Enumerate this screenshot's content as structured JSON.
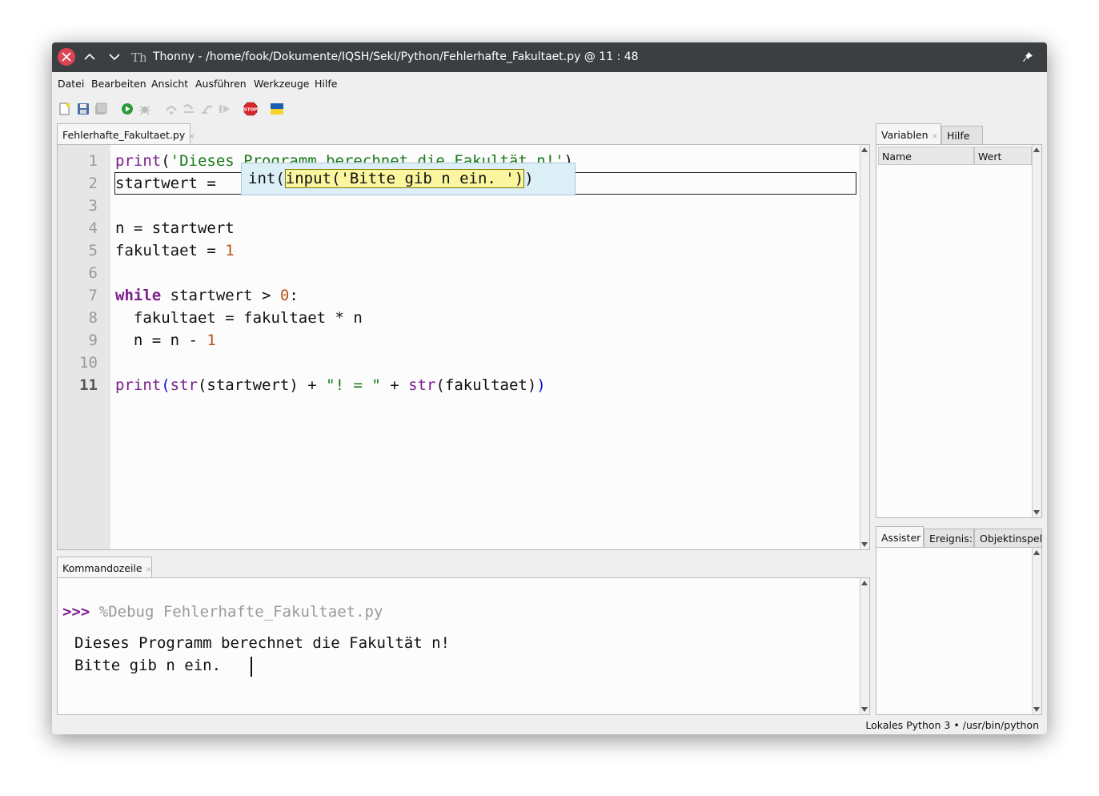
{
  "window": {
    "title": "Thonny - /home/fook/Dokumente/IQSH/SekI/Python/Fehlerhafte_Fakultaet.py @ 11 : 48",
    "icons": [
      "close-icon",
      "chevron-up-icon",
      "chevron-down-icon",
      "app-icon",
      "pin-icon"
    ]
  },
  "menu": {
    "items": [
      "Datei",
      "Bearbeiten",
      "Ansicht",
      "Ausführen",
      "Werkzeuge",
      "Hilfe"
    ]
  },
  "toolbar": {
    "icons": [
      "new-file-icon",
      "save-icon",
      "save-all-icon",
      "run-icon",
      "debug-icon",
      "step-over-icon",
      "step-into-icon",
      "step-out-icon",
      "resume-icon",
      "stop-icon",
      "ukraine-flag-icon"
    ],
    "stop_label": "STOP"
  },
  "editor": {
    "tab_label": "Fehlerhafte_Fakultaet.py",
    "tab_close": "×",
    "line_numbers": [
      "1",
      "2",
      "3",
      "4",
      "5",
      "6",
      "7",
      "8",
      "9",
      "10",
      "11"
    ],
    "lines": [
      {
        "plain_start": "",
        "kw": "print",
        "rest": "(",
        "str": "'Dieses Programm berechnet die Fakultät n!'",
        "end": ")"
      },
      {
        "text": "startwert = "
      },
      {
        "text": ""
      },
      {
        "text": "n = startwert"
      },
      {
        "text": "fakultaet = ",
        "num": "1"
      },
      {
        "text": ""
      },
      {
        "kw": "while",
        "text": " startwert > ",
        "num": "0",
        "end": ":"
      },
      {
        "text": "  fakultaet = fakultaet * n"
      },
      {
        "text": "  n = n - ",
        "num": "1"
      },
      {
        "text": ""
      },
      {
        "kw": "print",
        "b1": "(",
        "kw2": "str",
        "mid": "(startwert) + ",
        "str": "\"! = \"",
        "mid2": " + ",
        "kw3": "str",
        "mid3": "(fakultaet)",
        "b2": ")"
      }
    ],
    "calltip": {
      "prefix": "int(",
      "highlight": "input('Bitte gib n ein. ')",
      "suffix": ")"
    }
  },
  "shell": {
    "tab_label": "Kommandozeile",
    "tab_close": "×",
    "prompt": ">>>",
    "command": "%Debug Fehlerhafte_Fakultaet.py",
    "output": [
      "Dieses Programm berechnet die Fakultät n!",
      "Bitte gib n ein. "
    ]
  },
  "variables": {
    "tabs": [
      "Variablen",
      "Hilfe"
    ],
    "tab_close": "×",
    "columns": [
      "Name",
      "Wert"
    ]
  },
  "assistant": {
    "tabs": [
      "Assister",
      "Ereignis:",
      "Objektinspel"
    ]
  },
  "status": {
    "interpreter": "Lokales Python 3",
    "separator": "•",
    "path": "/usr/bin/python"
  }
}
